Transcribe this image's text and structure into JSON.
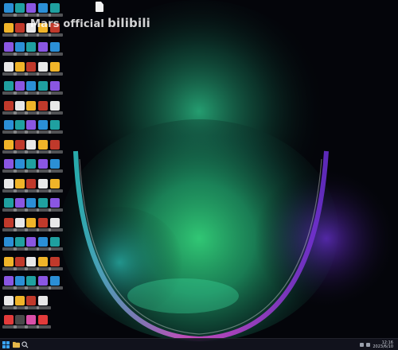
{
  "screen": {
    "type": "windows-desktop"
  },
  "wallpaper": {
    "colors": {
      "outer_glow_green": "#1f7a55",
      "bright_green": "#33d17a",
      "cyan": "#2ec7c7",
      "pink_rim": "#e34fd2",
      "violet": "#6b2fd6",
      "base": "#04050a"
    }
  },
  "watermark": {
    "author": "Mars official",
    "brand": "bilibili"
  },
  "desktop": {
    "icon_palette": [
      "#2b8fd6",
      "#e23b3b",
      "#f0b429",
      "#3cb371",
      "#8a56e2",
      "#d94fa8",
      "#e8e8e8",
      "#ff7a1a",
      "#1fa0a0",
      "#4a4a4a",
      "#c0392b",
      "#5dade2"
    ],
    "file_icon": "document-icon"
  },
  "taskbar": {
    "start_icon": "windows-start-icon",
    "search_icon": "search-icon",
    "tray": {
      "clock_time": "12:16",
      "clock_date": "2023/6/10"
    },
    "colors": {
      "bg": "#12141e",
      "accent": "#3aa3ff"
    }
  }
}
